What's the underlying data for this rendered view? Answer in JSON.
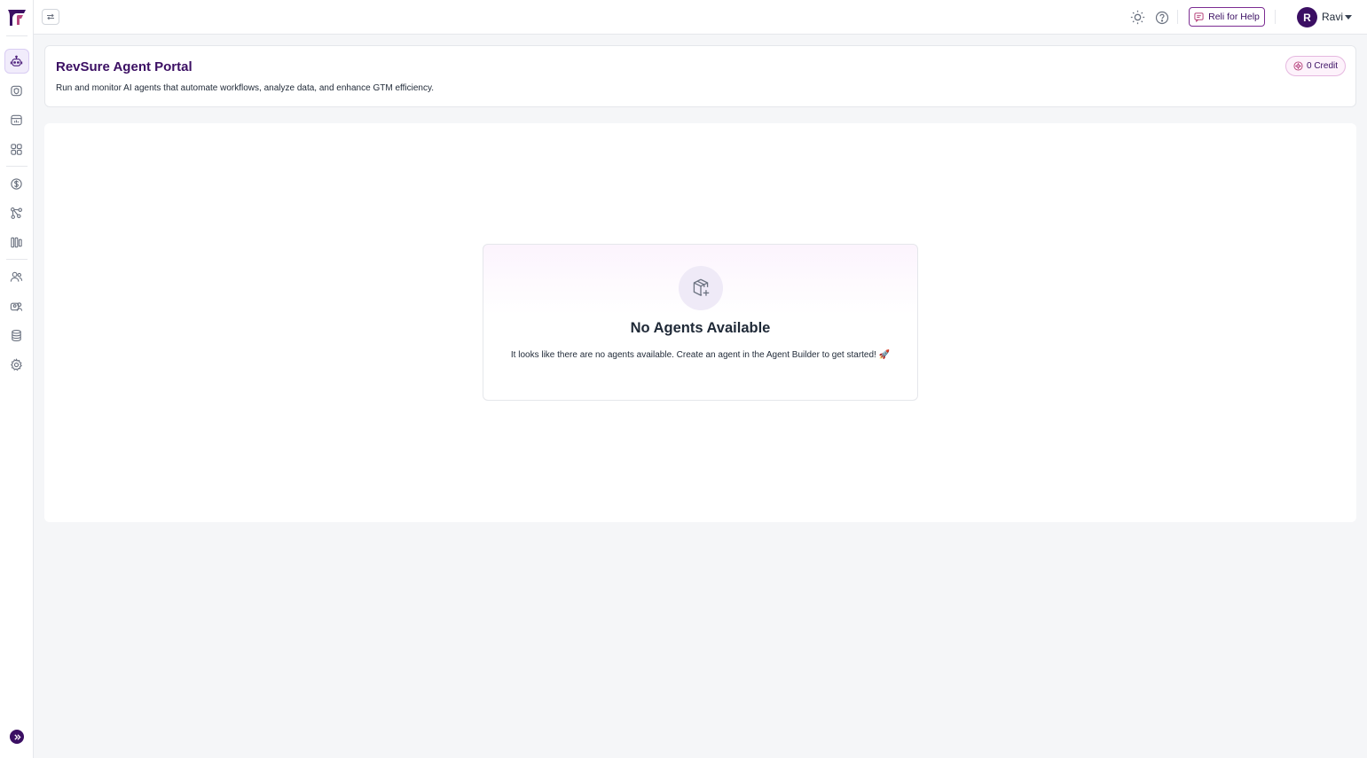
{
  "topbar": {
    "reli_label": "Reli for Help",
    "user_initial": "R",
    "user_name": "Ravi"
  },
  "header": {
    "title": "RevSure Agent Portal",
    "subtitle": "Run and monitor AI agents that automate workflows, analyze data, and enhance GTM efficiency.",
    "credit_label": "0 Credit"
  },
  "empty_state": {
    "title": "No Agents Available",
    "description": "It looks like there are no agents available. Create an agent in the Agent Builder to get started! 🚀"
  },
  "sidebar": {
    "icons": [
      "agent-icon",
      "shield-icon",
      "calendar-chart-icon",
      "apps-grid-icon",
      "dollar-icon",
      "workflow-icon",
      "columns-icon",
      "users-icon",
      "team-icon",
      "database-icon",
      "settings-gear-icon"
    ]
  },
  "colors": {
    "brand": "#3b0f63",
    "accent_border": "#7c2d92"
  }
}
